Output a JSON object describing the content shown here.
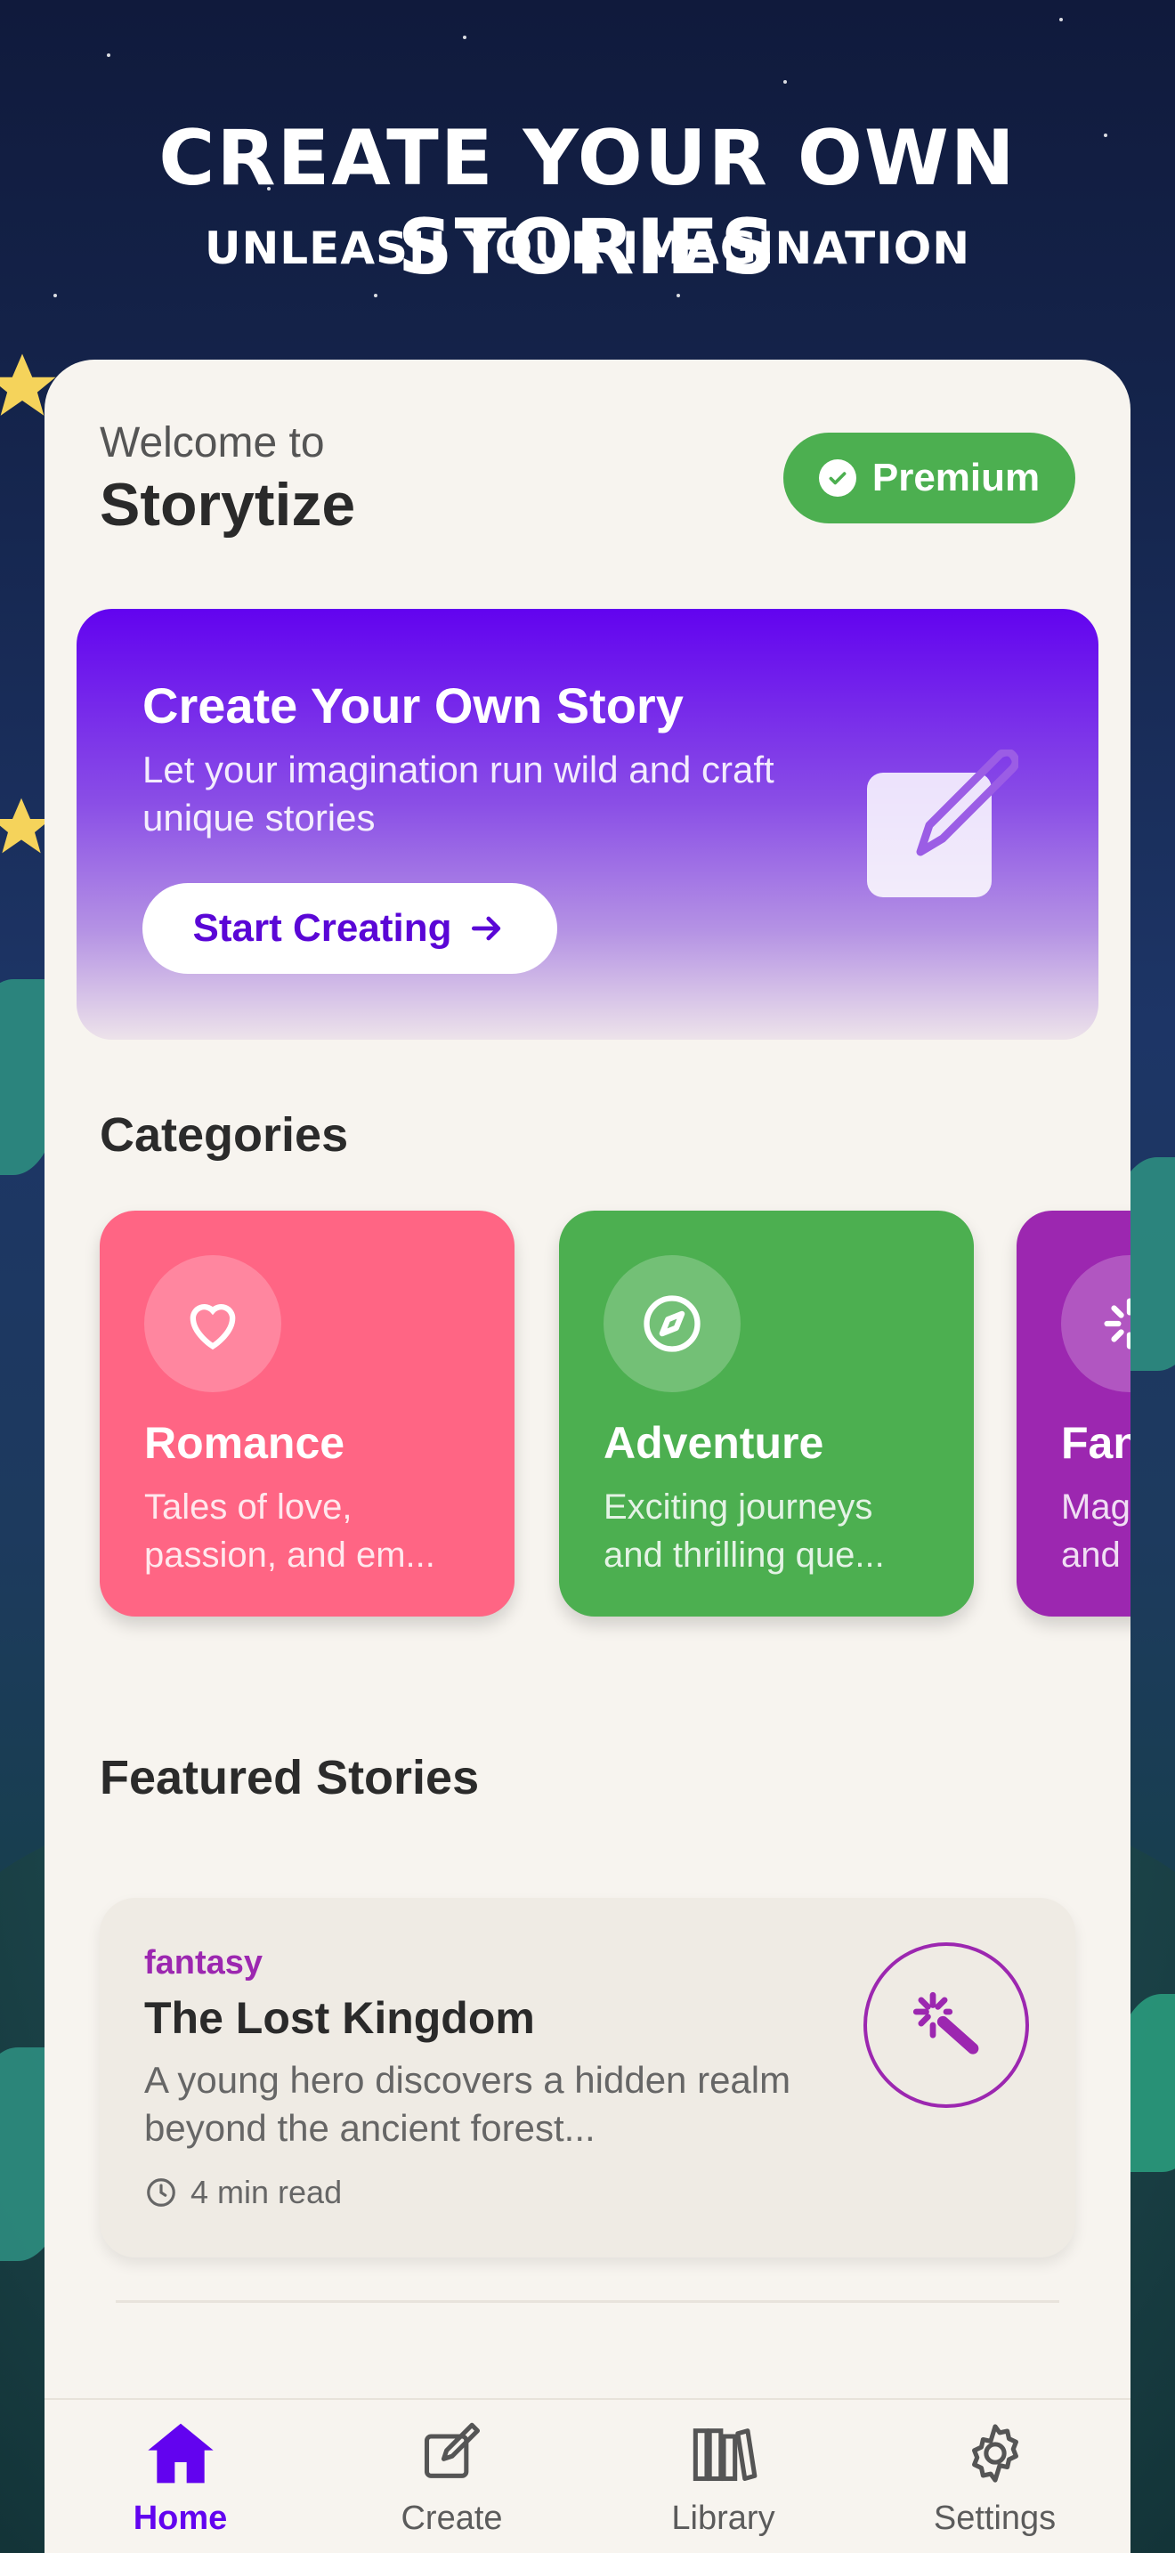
{
  "header": {
    "title": "CREATE YOUR OWN STORIES",
    "subtitle": "UNLEASH YOUR IMAGINATION"
  },
  "welcome": {
    "greeting": "Welcome to",
    "app_name": "Storytize",
    "badge": "Premium"
  },
  "banner": {
    "title": "Create Your Own Story",
    "text": "Let your imagination run wild and craft unique stories",
    "button": "Start Creating"
  },
  "categories": {
    "title": "Categories",
    "items": [
      {
        "name": "Romance",
        "desc_line1": "Tales of love,",
        "desc_line2": "passion, and em...",
        "icon": "heart-icon",
        "color": "#ff6584"
      },
      {
        "name": "Adventure",
        "desc_line1": "Exciting journeys",
        "desc_line2": "and thrilling que...",
        "icon": "compass-icon",
        "color": "#4caf50"
      },
      {
        "name": "Fan",
        "desc_line1": "Mag",
        "desc_line2": "and",
        "icon": "sparkle-icon",
        "color": "#9c27b0"
      }
    ]
  },
  "featured": {
    "title": "Featured Stories",
    "story": {
      "category": "fantasy",
      "title": "The Lost Kingdom",
      "description": "A young hero discovers a hidden realm beyond the ancient forest...",
      "read_time": "4 min read",
      "icon": "magic-wand-icon"
    }
  },
  "nav": {
    "items": [
      {
        "label": "Home",
        "icon": "home-icon",
        "active": true
      },
      {
        "label": "Create",
        "icon": "edit-icon",
        "active": false
      },
      {
        "label": "Library",
        "icon": "library-icon",
        "active": false
      },
      {
        "label": "Settings",
        "icon": "gear-icon",
        "active": false
      }
    ]
  },
  "colors": {
    "accent": "#6203ef",
    "premium": "#4caf50",
    "fantasy": "#9c27b0",
    "card_bg": "#f7f4ef"
  }
}
